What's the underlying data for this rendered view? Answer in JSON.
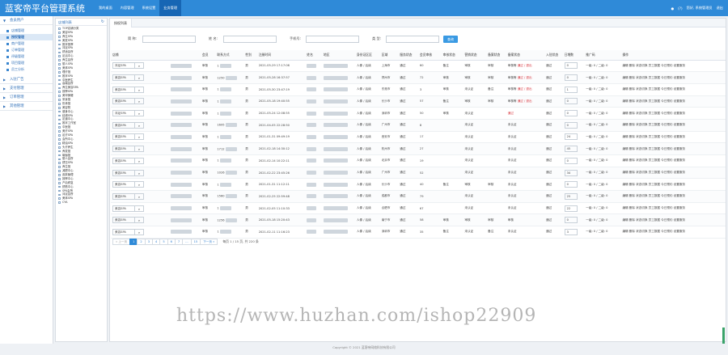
{
  "app": {
    "title": "蓝客帝平台管理系统",
    "brand_color": "#2f8ad8",
    "top_nav": [
      "我的桌面",
      "内容管理",
      "系统设置",
      "业务管理"
    ],
    "top_nav_active": 3,
    "user_label": "(?)",
    "user_greeting": "您好, 系统管理员",
    "logout": "退出"
  },
  "sidebar": {
    "group_top": "会员用户",
    "items": [
      "店铺管理",
      "授权管理",
      "商户管理",
      "订单管理",
      "评级管理",
      "项目管理",
      "员工分析"
    ],
    "active_index": 1,
    "groups": [
      "入驻广告",
      "支付管理",
      "订单管理",
      "其他管理"
    ]
  },
  "tree": {
    "title": "店铺列表",
    "items": [
      "TOP店铺分类",
      "美容SPA",
      "养生SPA",
      "美发SPA",
      "推拿按摩",
      "沐足SPA",
      "舒适会所",
      "足浴中心",
      "养生会所",
      "丽人SPA",
      "美体SPA",
      "理疗馆",
      "推拿SPA",
      "中医养生",
      "高端会所",
      "养生美容SPA",
      "按摩SPA",
      "美甲美睫",
      "采耳馆",
      "形体馆",
      "美容院",
      "健身中心",
      "纹绣SPA",
      "足道中心",
      "推拿工作室",
      "中医馆",
      "美疗SPA",
      "足疗SPA",
      "会所中心",
      "精油SPA",
      "头疗养生",
      "养发馆",
      "瑜伽馆",
      "丽人会所",
      "舒压SPA",
      "养生馆",
      "减肥中心",
      "皮肤管理",
      "按摩中心",
      "产后修复",
      "舒筋中心",
      "SPA会所",
      "沐足会所",
      "美体SPA",
      "CYA"
    ]
  },
  "main": {
    "tab": "授权列表",
    "filters": {
      "name_label": "简 称:",
      "name2_label": "姓 名:",
      "phone_label": "手机号:",
      "type_label": "类 型:",
      "query_button": "查询"
    },
    "columns": [
      "店铺",
      "",
      "会员",
      "联系方式",
      "性别",
      "注册时间",
      "姓名",
      "地区",
      "身份证区区",
      "区域",
      "服务状态",
      "会员审核",
      "审核状态",
      "营销状态",
      "备案状态",
      "备案状态",
      "入驻状态",
      "日增数",
      "推广码",
      "操作"
    ],
    "rows": [
      {
        "shop": "沐足SPA",
        "member": "审核",
        "phone": "1",
        "gender": "男",
        "reg": "2021-05-29 17:17:06",
        "region": "上海市",
        "ssn": "人像 / 后续",
        "status": "通过",
        "count": "60",
        "m2": "备注",
        "audit": "审核",
        "mk": "审核",
        "rec": "审核等 ",
        "rec2": "通过 / 退出",
        "settle": "通过",
        "daily": "0",
        "promo": "一级: 0 / 二级: 0"
      },
      {
        "shop": "美容SPA",
        "member": "审核",
        "phone": "1250",
        "gender": "男",
        "reg": "2021-05-28 16:37:57",
        "region": "郑州市",
        "ssn": "人像 / 后续",
        "status": "通过",
        "count": "72",
        "m2": "审核",
        "audit": "审核",
        "mk": "审核",
        "rec": "审核等 ",
        "rec2": "通过 / 退出",
        "settle": "通过",
        "daily": "0",
        "promo": "一级: 0 / 二级: 0"
      },
      {
        "shop": "美容SPA",
        "member": "审核",
        "phone": "1",
        "gender": "男",
        "reg": "2021-05-30 23:47:19",
        "region": "东莞市",
        "ssn": "人像 / 后续",
        "status": "通过",
        "count": "3",
        "m2": "审核",
        "audit": "未认证",
        "mk": "备注",
        "rec": "审核等 ",
        "rec2": "通过 / 退出",
        "settle": "通过",
        "daily": "1",
        "promo": "一级: 0 / 二级: 0"
      },
      {
        "shop": "美容SPA",
        "member": "审核",
        "phone": "1",
        "gender": "男",
        "reg": "2021-05-18 19:40:55",
        "region": "长沙市",
        "ssn": "人像 / 后续",
        "status": "通过",
        "count": "57",
        "m2": "备注",
        "audit": "审核",
        "mk": "审核",
        "rec": "审核等 ",
        "rec2": "通过 / 退出",
        "settle": "通过",
        "daily": "0",
        "promo": "一级: 0 / 二级: 0"
      },
      {
        "shop": "沐足SPA",
        "member": "审核",
        "phone": "1",
        "gender": "男",
        "reg": "2021-05-24 12:08:55",
        "region": "深圳市",
        "ssn": "人像 / 后续",
        "status": "通过",
        "count": "50",
        "m2": "审核",
        "audit": "未认证",
        "mk": "",
        "rec": "",
        "rec2": "通过",
        "settle": "通过",
        "daily": "0",
        "promo": "一级: 0 / 二级: 0"
      },
      {
        "shop": "美容SPA",
        "member": "审核",
        "phone": "1695",
        "gender": "男",
        "reg": "2021-04-05 22:28:50",
        "region": "广州市",
        "ssn": "人像 / 后续",
        "status": "通过",
        "count": "8",
        "m2": "",
        "audit": "未认证",
        "mk": "",
        "rec": "未认证",
        "rec2": "",
        "settle": "通过",
        "daily": "0",
        "promo": "一级: 0 / 二级: 0"
      },
      {
        "shop": "美容SPA",
        "member": "审核",
        "phone": "1",
        "gender": "男",
        "reg": "2021-01-31 09:49:19",
        "region": "西安市",
        "ssn": "人像 / 后续",
        "status": "通过",
        "count": "17",
        "m2": "",
        "audit": "未认证",
        "mk": "",
        "rec": "未认证",
        "rec2": "",
        "settle": "通过",
        "daily": "24",
        "promo": "一级: 0 / 二级: 0"
      },
      {
        "shop": "美容SPA",
        "member": "审核",
        "phone": "1712",
        "gender": "男",
        "reg": "2021-02-18 14:30:12",
        "region": "杭州市",
        "ssn": "人像 / 后续",
        "status": "通过",
        "count": "27",
        "m2": "",
        "audit": "未认证",
        "mk": "",
        "rec": "未认证",
        "rec2": "",
        "settle": "通过",
        "daily": "45",
        "promo": "一级: 0 / 二级: 0"
      },
      {
        "shop": "美容SPA",
        "member": "审核",
        "phone": "1",
        "gender": "男",
        "reg": "2021-02-14 10:22:11",
        "region": "北京市",
        "ssn": "人像 / 后续",
        "status": "通过",
        "count": "19",
        "m2": "",
        "audit": "未认证",
        "mk": "",
        "rec": "未认证",
        "rec2": "",
        "settle": "通过",
        "daily": "0",
        "promo": "一级: 0 / 二级: 0"
      },
      {
        "shop": "美容SPA",
        "member": "审核",
        "phone": "1026",
        "gender": "男",
        "reg": "2021-02-22 23:45:26",
        "region": "广州市",
        "ssn": "人像 / 后续",
        "status": "通过",
        "count": "52",
        "m2": "",
        "audit": "未认证",
        "mk": "",
        "rec": "未认证",
        "rec2": "",
        "settle": "通过",
        "daily": "34",
        "promo": "一级: 0 / 二级: 0"
      },
      {
        "shop": "美容SPA",
        "member": "审核",
        "phone": "1",
        "gender": "男",
        "reg": "2021-01-31 11:12:11",
        "region": "长沙市",
        "ssn": "人像 / 后续",
        "status": "通过",
        "count": "40",
        "m2": "备注",
        "audit": "审核",
        "mk": "审核",
        "rec": "未认证",
        "rec2": "",
        "settle": "通过",
        "daily": "0",
        "promo": "一级: 0 / 二级: 0"
      },
      {
        "shop": "美容SPA",
        "member": "审核",
        "phone": "1560",
        "gender": "男",
        "reg": "2021-02-25 22:59:48",
        "region": "成都市",
        "ssn": "人像 / 后续",
        "status": "通过",
        "count": "79",
        "m2": "",
        "audit": "未认证",
        "mk": "",
        "rec": "未认证",
        "rec2": "",
        "settle": "通过",
        "daily": "25",
        "promo": "一级: 0 / 二级: 0"
      },
      {
        "shop": "美容SPA",
        "member": "审核",
        "phone": "1",
        "gender": "男",
        "reg": "2021-02-05 11:10:33",
        "region": "合肥市",
        "ssn": "人像 / 后续",
        "status": "通过",
        "count": "67",
        "m2": "",
        "audit": "未认证",
        "mk": "",
        "rec": "未认证",
        "rec2": "",
        "settle": "通过",
        "daily": "22",
        "promo": "一级: 0 / 二级: 0"
      },
      {
        "shop": "美容SPA",
        "member": "审核",
        "phone": "1256",
        "gender": "男",
        "reg": "2021-05-18 15:20:43",
        "region": "南宁市",
        "ssn": "人像 / 后续",
        "status": "通过",
        "count": "58",
        "m2": "审核",
        "audit": "审核",
        "mk": "审核",
        "rec": "审核",
        "rec2": "",
        "settle": "通过",
        "daily": "0",
        "promo": "一级: 0 / 二级: 0"
      },
      {
        "shop": "美容SPA",
        "member": "审核",
        "phone": "1",
        "gender": "男",
        "reg": "2021-02-11 11:16:23",
        "region": "深圳市",
        "ssn": "人像 / 后续",
        "status": "通过",
        "count": "35",
        "m2": "备注",
        "audit": "未认证",
        "mk": "备注",
        "rec": "未认证",
        "rec2": "",
        "settle": "通过",
        "daily": "3",
        "promo": "一级: 0 / 二级: 0"
      }
    ],
    "row_actions": "编辑 删除 状态切换 员工数据 今日预约 设置服务",
    "select_placeholder": "请选择",
    "pager": {
      "prev": "« 上一页",
      "pages": [
        "1",
        "2",
        "3",
        "4",
        "5",
        "6",
        "7",
        "...",
        "15"
      ],
      "current_index": 0,
      "next": "下一页 »",
      "info": "每页 1 / 15 页, 共 220 条"
    }
  },
  "watermark": "https://www.huzhan.com/ishop22909",
  "footer": "Copyright © 2021 蓝客帝网络科技有限公司"
}
